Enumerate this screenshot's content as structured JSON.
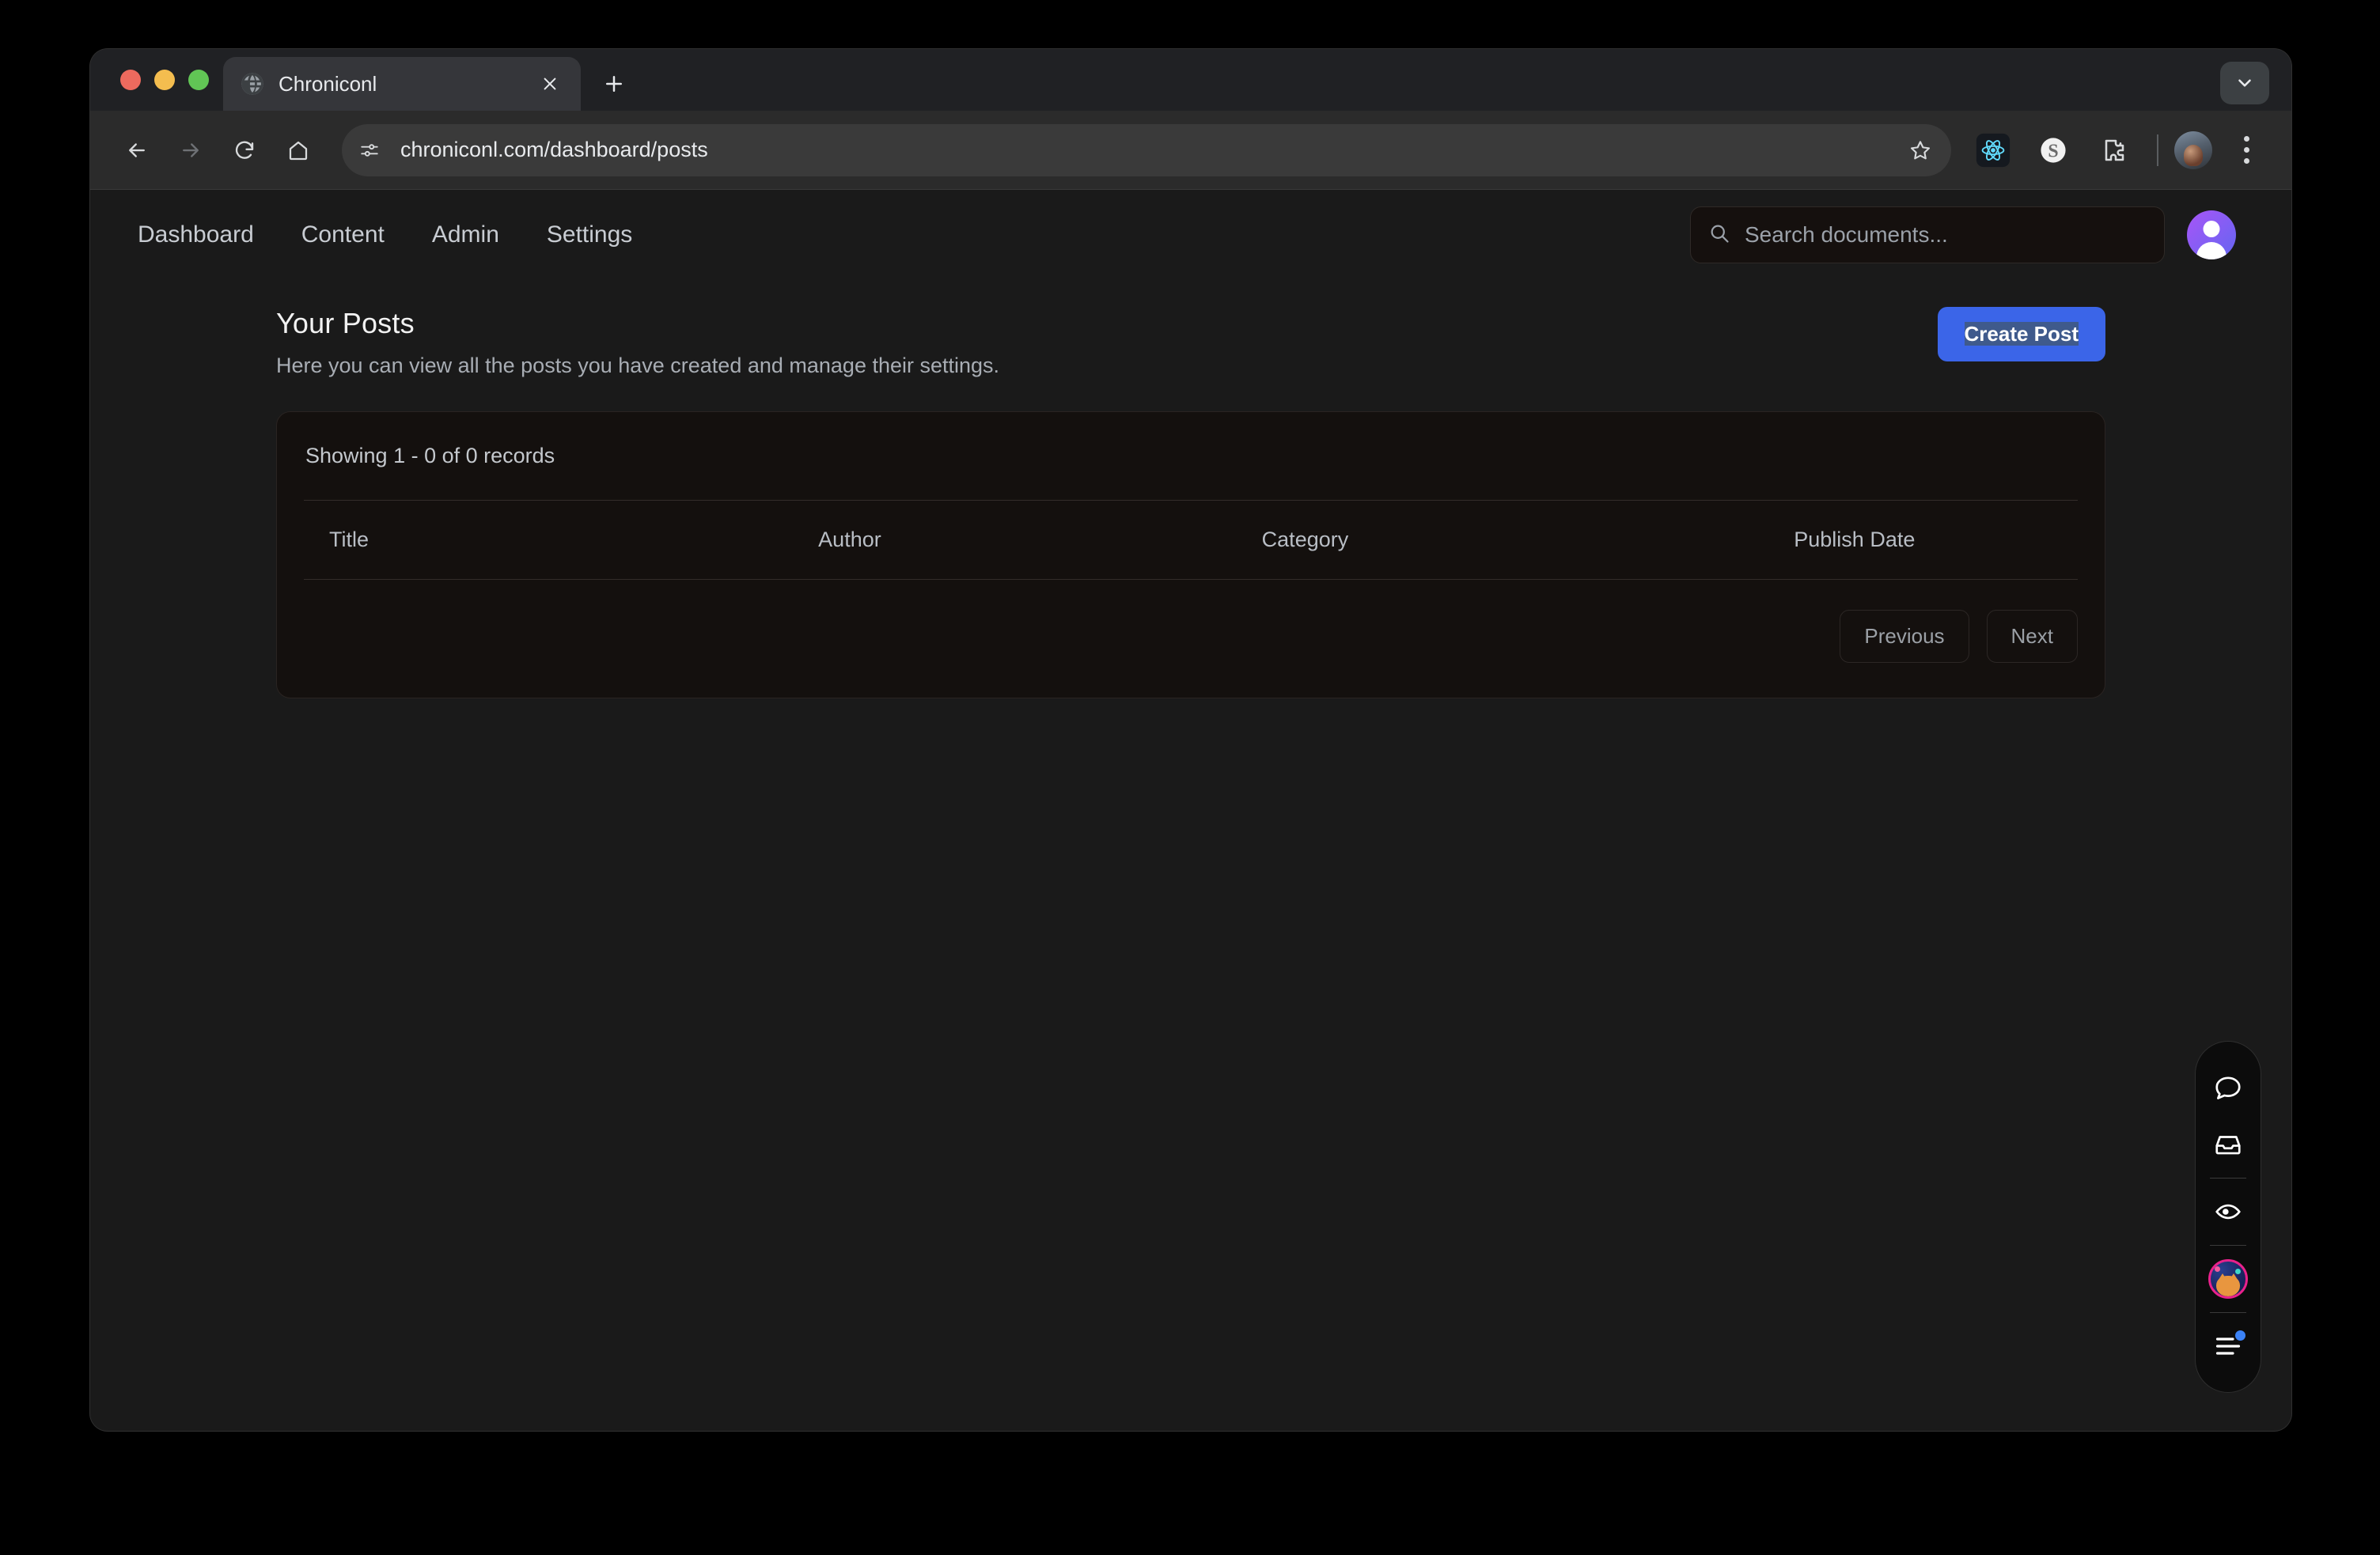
{
  "browser": {
    "tab": {
      "title": "Chroniconl",
      "favicon_icon": "globe-icon",
      "close_icon": "close-icon"
    },
    "new_tab_label": "+",
    "tab_search_icon": "chevron-down-icon",
    "toolbar": {
      "back_icon": "arrow-left-icon",
      "forward_icon": "arrow-right-icon",
      "reload_icon": "reload-icon",
      "home_icon": "home-icon",
      "site_info_icon": "tune-settings-icon",
      "url": "chroniconl.com/dashboard/posts",
      "bookmark_icon": "star-icon",
      "extensions": [
        {
          "name": "react-devtools-icon",
          "label": "React"
        },
        {
          "name": "stripe-extension-icon",
          "label": "S"
        },
        {
          "name": "puzzle-extensions-icon",
          "label": "Extensions"
        }
      ],
      "profile_icon": "profile-avatar",
      "menu_icon": "kebab-menu-icon"
    },
    "window_controls": {
      "close_color": "#ed6a5e",
      "minimize_color": "#f4bd4f",
      "maximize_color": "#61c555"
    }
  },
  "app": {
    "nav": [
      {
        "label": "Dashboard"
      },
      {
        "label": "Content"
      },
      {
        "label": "Admin"
      },
      {
        "label": "Settings"
      }
    ],
    "search": {
      "placeholder": "Search documents...",
      "icon": "search-icon"
    },
    "avatar_icon": "user-avatar",
    "header": {
      "title": "Your Posts",
      "subtitle": "Here you can view all the posts you have created and manage their settings.",
      "create_button": "Create Post",
      "create_button_color": "#3b65e8"
    },
    "table": {
      "records_label": "Showing 1 - 0 of 0 records",
      "columns": [
        "Title",
        "Author",
        "Category",
        "Publish Date"
      ],
      "rows": []
    },
    "pagination": {
      "previous": "Previous",
      "next": "Next"
    }
  },
  "float_widget": {
    "items": [
      {
        "icon": "chat-bubble-icon"
      },
      {
        "icon": "inbox-tray-icon"
      },
      {
        "icon": "eye-preview-icon"
      },
      {
        "icon": "cat-avatar-icon",
        "ring_color": "#e9218c"
      },
      {
        "icon": "menu-lines-icon",
        "badge_color": "#3b82f6"
      }
    ]
  }
}
